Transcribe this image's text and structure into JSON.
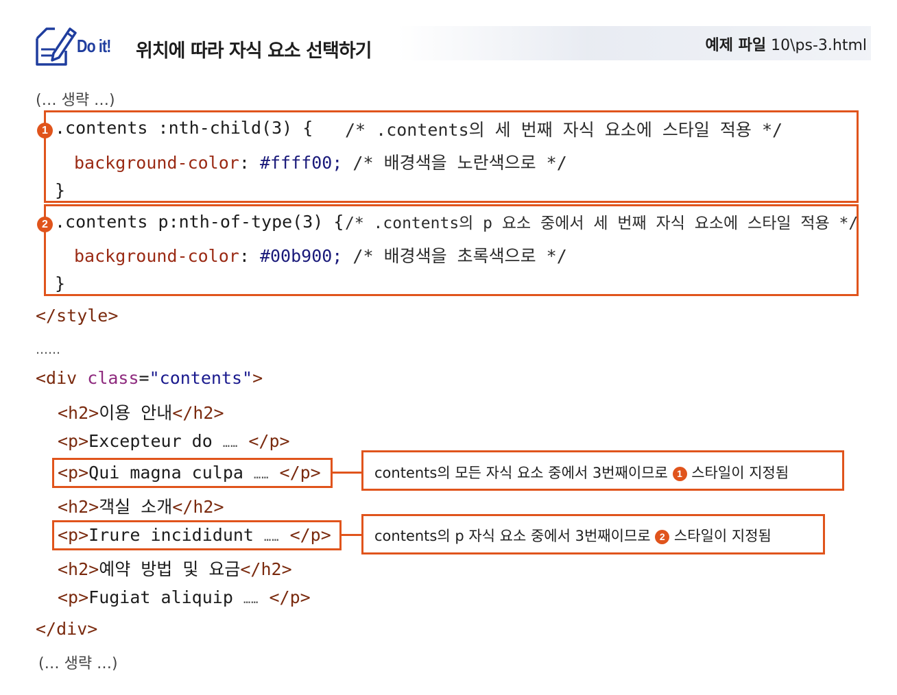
{
  "header": {
    "logo_text": "Do it!",
    "title": "위치에 따라 자식 요소 선택하기",
    "file_label": "예제 파일",
    "file_name": "10\\ps-3.html"
  },
  "code": {
    "omit_top": "(… 생략 …)",
    "rule1": {
      "badge": "1",
      "selector": ".contents :nth-child(3) {",
      "selector_comment": "/* .contents의 세 번째 자식 요소에 스타일 적용 */",
      "property": "background-color",
      "value": "#ffff00;",
      "value_comment": "/* 배경색을 노란색으로 */",
      "close": "}"
    },
    "rule2": {
      "badge": "2",
      "selector": ".contents p:nth-of-type(3) {",
      "selector_comment": "/* .contents의 p 요소 중에서 세 번째 자식 요소에 스타일 적용 */",
      "property": "background-color",
      "value": "#00b900;",
      "value_comment": "/* 배경색을 초록색으로 */",
      "close": "}"
    },
    "style_close": "</style>",
    "dots": "……",
    "div_open_tag": "<div ",
    "div_attr": "class",
    "div_eq": "=",
    "div_value": "\"contents\"",
    "div_gt": ">",
    "lines": [
      {
        "open": "<h2>",
        "text": "이용 안내",
        "close": "</h2>"
      },
      {
        "open": "<p>",
        "text": "Excepteur do ",
        "ellipsis": "……",
        "close": " </p>"
      },
      {
        "open": "<p>",
        "text": "Qui magna culpa ",
        "ellipsis": "……",
        "close": " </p>"
      },
      {
        "open": "<h2>",
        "text": "객실 소개",
        "close": "</h2>"
      },
      {
        "open": "<p>",
        "text": "Irure incididunt ",
        "ellipsis": "……",
        "close": " </p>"
      },
      {
        "open": "<h2>",
        "text": "예약 방법 및 요금",
        "close": "</h2>"
      },
      {
        "open": "<p>",
        "text": "Fugiat aliquip ",
        "ellipsis": "……",
        "close": " </p>"
      }
    ],
    "div_close": "</div>",
    "omit_bottom": "(… 생략 …)"
  },
  "callouts": [
    {
      "before": "contents의 모든 자식 요소 중에서 3번째이므로 ",
      "badge": "1",
      "after": " 스타일이 지정됨"
    },
    {
      "before": "contents의 p 자식 요소 중에서 3번째이므로 ",
      "badge": "2",
      "after": " 스타일이 지정됨"
    }
  ],
  "colors": {
    "accent": "#e0541c",
    "brand": "#1f3d9e"
  }
}
